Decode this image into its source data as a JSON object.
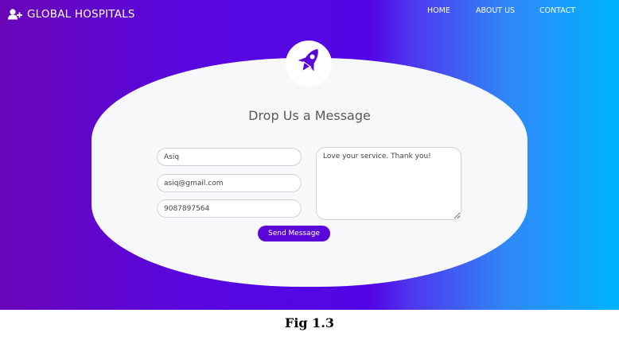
{
  "brand": {
    "name": "GLOBAL HOSPITALS",
    "icon": "user-plus-icon"
  },
  "nav": {
    "items": [
      "HOME",
      "ABOUT US",
      "CONTACT"
    ]
  },
  "badge": {
    "icon": "rocket-icon"
  },
  "form": {
    "title": "Drop Us a Message",
    "name_value": "Asiq",
    "email_value": "asiq@gmail.com",
    "phone_value": "9087897564",
    "message_value": "Love your service. Thank you!",
    "submit_label": "Send Message"
  },
  "caption": "Fig 1.3",
  "colors": {
    "gradient_start": "#6a05b8",
    "gradient_mid": "#5205e6",
    "gradient_end": "#00b3ff",
    "card": "#f7f8fa",
    "button": "#5a06d8",
    "rocket": "#5a06d8"
  }
}
